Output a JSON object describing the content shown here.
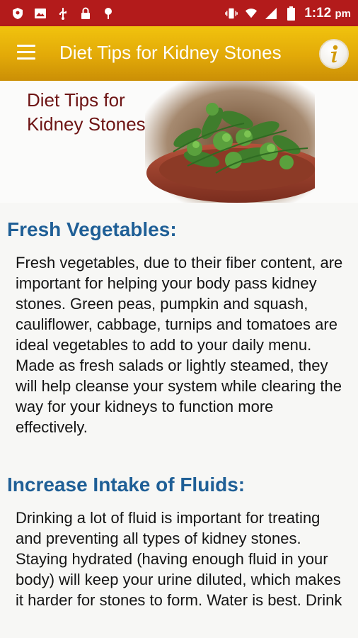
{
  "status_bar": {
    "time": "1:12",
    "time_suffix": "pm",
    "left_icons": [
      "shield-icon",
      "image-icon",
      "usb-icon",
      "lock-icon",
      "pin-icon"
    ],
    "right_icons": [
      "vibrate-icon",
      "wifi-icon",
      "signal-icon",
      "battery-icon"
    ]
  },
  "app_bar": {
    "title": "Diet Tips for Kidney Stones",
    "menu_icon": "hamburger-menu-icon",
    "info_icon": "info-icon"
  },
  "banner": {
    "line1": "Diet Tips for",
    "line2": "Kidney Stones",
    "image": "fresh-herbs-plate-image"
  },
  "sections": [
    {
      "title": "Fresh Vegetables:",
      "body": "Fresh vegetables, due to their fiber content, are important for helping your body pass kidney stones. Green peas, pumpkin and squash, cauliflower, cabbage, turnips and tomatoes are ideal vegetables to add to your daily menu. Made as fresh salads or lightly steamed, they will help cleanse your system while clearing the way for your kidneys to function more effectively."
    },
    {
      "title": "Increase Intake of Fluids:",
      "body": "Drinking a lot of fluid is important for treating and preventing all types of kidney stones. Staying hydrated (having enough fluid in your body) will keep your urine diluted, which makes it harder for stones to form. Water is best. Drink"
    }
  ],
  "colors": {
    "status_bar": "#b31b1b",
    "app_bar": "#e2a908",
    "section_title": "#1f5f96",
    "banner_text": "#6d1414"
  }
}
